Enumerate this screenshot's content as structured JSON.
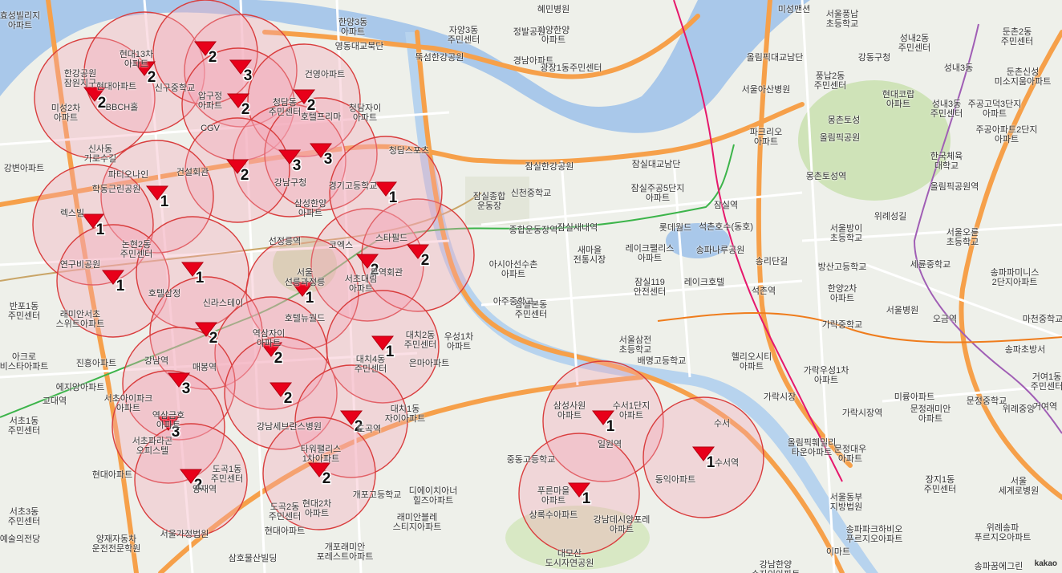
{
  "colors": {
    "water": "#a9c8ea",
    "land": "#eef0ea",
    "park": "#cfe3b8",
    "road_major": "#f6a04a",
    "road_minor": "#ffffff",
    "circle_fill": "#f3a7b6",
    "circle_stroke": "#d93d3d",
    "marker": "#e8001a",
    "subway_green": "#3cb44a",
    "subway_purple": "#a05eb5",
    "subway_pink": "#e6186c"
  },
  "attribution": "kakao",
  "labels": [
    {
      "id": "hyoseong",
      "text": "효성빌리지\n아파트"
    },
    {
      "id": "hanyang",
      "text": "한양3동\n아파트"
    },
    {
      "id": "hyemin",
      "text": "혜민병원"
    },
    {
      "id": "jayang3",
      "text": "자양3동\n주민센터"
    },
    {
      "id": "jayanghanyang",
      "text": "자양한양\n아파트"
    },
    {
      "id": "misung",
      "text": "미성맨션"
    },
    {
      "id": "pungnap_school",
      "text": "서울풍납\n초등학교"
    },
    {
      "id": "seongnae2",
      "text": "성내2동\n주민센터"
    },
    {
      "id": "gangdong_office",
      "text": "강동구청"
    },
    {
      "id": "dunchon2",
      "text": "둔촌2동\n주민센터"
    },
    {
      "id": "jeongbal",
      "text": "정발공원"
    },
    {
      "id": "gyeongnam",
      "text": "경남아파트"
    },
    {
      "id": "gwangjang",
      "text": "광장1동주민센터"
    },
    {
      "id": "ttukseom",
      "text": "뚝섬한강공원"
    },
    {
      "id": "yeongdong_bridge",
      "text": "영동대교북단"
    },
    {
      "id": "olympic_bridge",
      "text": "올림픽대교남단"
    },
    {
      "id": "pungnap2",
      "text": "풍납2동\n주민센터"
    },
    {
      "id": "asan",
      "text": "서울아산병원"
    },
    {
      "id": "gangdong_hosp",
      "text": "현대코랍\n아파트"
    },
    {
      "id": "seongnae3",
      "text": "성내3동\n주민센터"
    },
    {
      "id": "jugong3",
      "text": "주공고덕3단지\n아파트"
    },
    {
      "id": "hangang_jang",
      "text": "한강공원\n잠원지구"
    },
    {
      "id": "hyundai13",
      "text": "현대13차\n아파트"
    },
    {
      "id": "sinsa_station",
      "text": "신구중학교"
    },
    {
      "id": "hyundai_apt",
      "text": "현대아파트"
    },
    {
      "id": "misung2",
      "text": "미성2차\n아파트"
    },
    {
      "id": "bbch",
      "text": "BBCH홀"
    },
    {
      "id": "apgujeong",
      "text": "압구정\n아파트"
    },
    {
      "id": "cgv",
      "text": "CGV"
    },
    {
      "id": "cheongdam",
      "text": "청담동\n주민센터"
    },
    {
      "id": "hotel_prima",
      "text": "호텔프리마"
    },
    {
      "id": "geonyeong",
      "text": "건영아파트"
    },
    {
      "id": "cheongdam_apt",
      "text": "청담자이\n아파트"
    },
    {
      "id": "jamsil_hangang",
      "text": "잠실한강공원"
    },
    {
      "id": "jamsil_bridge",
      "text": "잠실대교남단"
    },
    {
      "id": "parkrio",
      "text": "파크리오\n아파트"
    },
    {
      "id": "mongchon",
      "text": "몽촌토성"
    },
    {
      "id": "olympic_park",
      "text": "올림픽공원"
    },
    {
      "id": "olympic_station",
      "text": "올림픽공원역"
    },
    {
      "id": "sinsa_dong",
      "text": "신사동\n가로수길"
    },
    {
      "id": "gangbyeon_apt",
      "text": "강변아파트"
    },
    {
      "id": "paticonaine",
      "text": "파티오나인"
    },
    {
      "id": "construction",
      "text": "건설회관"
    },
    {
      "id": "gangnam_gu",
      "text": "강남구청"
    },
    {
      "id": "samsunghanyang",
      "text": "삼성한양\n아파트"
    },
    {
      "id": "gyeonggi_school",
      "text": "경기고등학교"
    },
    {
      "id": "chungdam_sports",
      "text": "청담스포츠"
    },
    {
      "id": "sports_complex",
      "text": "잠실종합\n운동장"
    },
    {
      "id": "sinchun_school",
      "text": "신천중학교"
    },
    {
      "id": "jamsil_jugong5",
      "text": "잠실주공5단지\n아파트"
    },
    {
      "id": "jamsil_station",
      "text": "잠실역"
    },
    {
      "id": "sports_station",
      "text": "종합운동장역"
    },
    {
      "id": "jamsilsaenae",
      "text": "잠실새내역"
    },
    {
      "id": "lotte_world",
      "text": "롯데월드"
    },
    {
      "id": "seokchon_lake",
      "text": "석촌호수(동호)"
    },
    {
      "id": "nonhyeon",
      "text": "논현2동\n주민센터"
    },
    {
      "id": "hakdong",
      "text": "학동근린공원"
    },
    {
      "id": "lexell",
      "text": "렉스빌"
    },
    {
      "id": "seolleung",
      "text": "선정릉역"
    },
    {
      "id": "seolleung_park",
      "text": "서울\n선릉과정릉"
    },
    {
      "id": "starfield",
      "text": "스타필드"
    },
    {
      "id": "coex",
      "text": "코엑스"
    },
    {
      "id": "trade_center",
      "text": "무역회관"
    },
    {
      "id": "asia_apt",
      "text": "아시아선수촌\n아파트"
    },
    {
      "id": "saemaeul",
      "text": "새마을\n전통시장"
    },
    {
      "id": "leichpalace",
      "text": "레이크팰리스\n아파트"
    },
    {
      "id": "songpa_park",
      "text": "송파나루공원"
    },
    {
      "id": "songridan",
      "text": "송리단길"
    },
    {
      "id": "bangi_school",
      "text": "방산고등학교"
    },
    {
      "id": "seoul_bangi",
      "text": "서울방이\n초등학교"
    },
    {
      "id": "oryun_school",
      "text": "서울오륜\n초등학교"
    },
    {
      "id": "sejong_school",
      "text": "세륜중학교"
    },
    {
      "id": "songpa_imarket",
      "text": "송파파미니스\n2단지아파트"
    },
    {
      "id": "yeonguhgongwon",
      "text": "연구비공원"
    },
    {
      "id": "banpo1",
      "text": "반포1동\n주민센터"
    },
    {
      "id": "hotelbansan",
      "text": "호텔삼정"
    },
    {
      "id": "shinra",
      "text": "신라스테이"
    },
    {
      "id": "hotelnew",
      "text": "호텔뉴월드"
    },
    {
      "id": "jamsil_bonjeong",
      "text": "잠실본동\n주민센터"
    },
    {
      "id": "jamsil119",
      "text": "잠실119\n안전센터"
    },
    {
      "id": "lake_hotel",
      "text": "레이크호텔"
    },
    {
      "id": "seokchon_station",
      "text": "석촌역"
    },
    {
      "id": "hanyang2",
      "text": "한양2차\n아파트"
    },
    {
      "id": "seoul_hosp",
      "text": "서울병원"
    },
    {
      "id": "ogeum",
      "text": "오금역"
    },
    {
      "id": "ajoo_school",
      "text": "아주중학교"
    },
    {
      "id": "raemian",
      "text": "래미안서초\n스위트아파트"
    },
    {
      "id": "yeoksam",
      "text": "역삼자이\n아파트"
    },
    {
      "id": "daechi2",
      "text": "대치2동\n주민센터"
    },
    {
      "id": "useong1",
      "text": "우성1차\n아파트"
    },
    {
      "id": "samjeon_school",
      "text": "서울삼전\n초등학교"
    },
    {
      "id": "baemyung",
      "text": "배명고등학교"
    },
    {
      "id": "gaorakgyo",
      "text": "가락중학교"
    },
    {
      "id": "samsung_hosp",
      "text": "삼성서울병원"
    },
    {
      "id": "heliocity",
      "text": "헬리오시티\n아파트"
    },
    {
      "id": "garak_market",
      "text": "가락시장"
    },
    {
      "id": "garak1",
      "text": "가락우성1차\n아파트"
    },
    {
      "id": "garak_station",
      "text": "가락시장역"
    },
    {
      "id": "mirung_school",
      "text": "미륭아파트"
    },
    {
      "id": "masteeong",
      "text": "마천중학교"
    },
    {
      "id": "songpa_bangi",
      "text": "송파초방서"
    },
    {
      "id": "geoyeo1",
      "text": "거여1동\n주민센터"
    },
    {
      "id": "akiro",
      "text": "아크로\n비스타아파트"
    },
    {
      "id": "jinheung",
      "text": "진흥아파트"
    },
    {
      "id": "gangnam_station",
      "text": "강남역"
    },
    {
      "id": "yesidian",
      "text": "에지앙아파트"
    },
    {
      "id": "gyodae",
      "text": "교대역"
    },
    {
      "id": "seocho1",
      "text": "서초1동\n주민센터"
    },
    {
      "id": "seocho_ipark",
      "text": "서초아이파크\n아파트"
    },
    {
      "id": "hyundai_apt2",
      "text": "현대아파트"
    },
    {
      "id": "seocho3",
      "text": "서초3동\n주민센터"
    },
    {
      "id": "yesul",
      "text": "예술의전당"
    },
    {
      "id": "seocho_office",
      "text": "서초파라곤\n오피스텔"
    },
    {
      "id": "yeoksamgeum",
      "text": "역삼금호\n아파트"
    },
    {
      "id": "seochodaebang",
      "text": "서초대림\n아파트"
    },
    {
      "id": "dogok1",
      "text": "도곡1동\n주민센터"
    },
    {
      "id": "yangjae",
      "text": "양재역"
    },
    {
      "id": "seoul_medical",
      "text": "서울가정법원"
    },
    {
      "id": "yangjae_car",
      "text": "양재자동차\n운전전문학원"
    },
    {
      "id": "gangnam_hosp",
      "text": "강남세브란스병원"
    },
    {
      "id": "maebong",
      "text": "매봉역"
    },
    {
      "id": "tower_palace",
      "text": "타워팰리스\n1차아파트"
    },
    {
      "id": "dogok_station",
      "text": "도곡역"
    },
    {
      "id": "daechi4",
      "text": "대치4동\n주민센터"
    },
    {
      "id": "eunma",
      "text": "은마아파트"
    },
    {
      "id": "daechi_apt",
      "text": "대치1동\n자이아파트"
    },
    {
      "id": "gaepo_school",
      "text": "개포고등학교"
    },
    {
      "id": "dogok2",
      "text": "도곡2동\n주민센터"
    },
    {
      "id": "hyundai2",
      "text": "현대2차\n아파트"
    },
    {
      "id": "dogok_apt",
      "text": "현대아파트"
    },
    {
      "id": "diech",
      "text": "디에이치아너\n힐즈아파트"
    },
    {
      "id": "raemian_blessy",
      "text": "래미안블레\n스티지아파트"
    },
    {
      "id": "gaepo_raemian",
      "text": "개포래미안\n포레스트아파트"
    },
    {
      "id": "samho_building",
      "text": "삼호물산빌딩"
    },
    {
      "id": "jungdong_school",
      "text": "중동고등학교"
    },
    {
      "id": "samsung_sawon",
      "text": "삼성사원\n아파트"
    },
    {
      "id": "suseo1",
      "text": "수서1단지\n아파트"
    },
    {
      "id": "ilwon",
      "text": "일원역"
    },
    {
      "id": "pureun",
      "text": "푸른마을\n아파트"
    },
    {
      "id": "sangnok",
      "text": "상록수아파트"
    },
    {
      "id": "gangnam_apt",
      "text": "강남데시앙포레\n아파트"
    },
    {
      "id": "daemo_park",
      "text": "대모산\n도시자연공원"
    },
    {
      "id": "suseo_station",
      "text": "수서역"
    },
    {
      "id": "suseo",
      "text": "수서"
    },
    {
      "id": "dongsu",
      "text": "동익아파트"
    },
    {
      "id": "olympic_family",
      "text": "올림픽훼밀리\n타운아파트"
    },
    {
      "id": "munjeong_apt",
      "text": "문정래미안\n아파트"
    },
    {
      "id": "munjeong_school",
      "text": "문정중학교"
    },
    {
      "id": "jangji1",
      "text": "장지1동\n주민센터"
    },
    {
      "id": "seoul_east",
      "text": "서울동부\n지방법원"
    },
    {
      "id": "munjeong_daewoo",
      "text": "문정대우\n아파트"
    },
    {
      "id": "songpa_pureun",
      "text": "송파파크하비오\n푸르지오아파트"
    },
    {
      "id": "wirye",
      "text": "위례송파\n푸르지오아파트"
    },
    {
      "id": "seoul_school",
      "text": "서울\n세계로병원"
    },
    {
      "id": "gangnam_hanyang",
      "text": "강남한양\n수자인아파트"
    },
    {
      "id": "imatt",
      "text": "이마트"
    },
    {
      "id": "songpa_green",
      "text": "송파꿈에그린"
    },
    {
      "id": "wiryejungang",
      "text": "위례중앙"
    },
    {
      "id": "geoyeo",
      "text": "거여역"
    },
    {
      "id": "mongchon_station",
      "text": "몽촌토성역"
    },
    {
      "id": "gangil",
      "text": "한국체육\n대학교"
    },
    {
      "id": "jugong2",
      "text": "주공아파트2단지\n아파트"
    },
    {
      "id": "dunchon_apt",
      "text": "둔촌신성\n미소지움아파트"
    },
    {
      "id": "seongnae_3",
      "text": "성내3동"
    },
    {
      "id": "wolgye",
      "text": "위례성길"
    }
  ],
  "clusters": [
    {
      "count": "2"
    },
    {
      "count": "2"
    },
    {
      "count": "3"
    },
    {
      "count": "2"
    },
    {
      "count": "2"
    },
    {
      "count": "2"
    },
    {
      "count": "3"
    },
    {
      "count": "3"
    },
    {
      "count": "2"
    },
    {
      "count": "1"
    },
    {
      "count": "1"
    },
    {
      "count": "2"
    },
    {
      "count": "2"
    },
    {
      "count": "1"
    },
    {
      "count": "1"
    },
    {
      "count": "1"
    },
    {
      "count": "1"
    },
    {
      "count": "2"
    },
    {
      "count": "2"
    },
    {
      "count": "1"
    },
    {
      "count": "3"
    },
    {
      "count": "2"
    },
    {
      "count": "3"
    },
    {
      "count": "2"
    },
    {
      "count": "2"
    },
    {
      "count": "2"
    },
    {
      "count": "1"
    },
    {
      "count": "1"
    },
    {
      "count": "1"
    }
  ]
}
